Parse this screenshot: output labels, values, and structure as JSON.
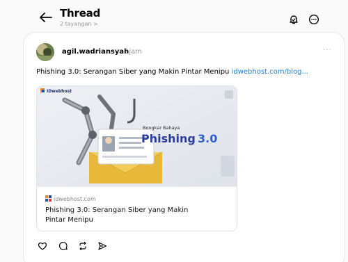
{
  "header": {
    "title": "Thread",
    "views": "2 tayangan",
    "views_chevron": ">",
    "icons": [
      "back-arrow-icon",
      "notification-bell-icon",
      "more-options-icon"
    ]
  },
  "post": {
    "username": "agil.wadriansyah",
    "time": "1jam",
    "more": "···",
    "text": "Phishing 3.0: Serangan Siber yang Makin Pintar Menipu",
    "link_text": "idwebhost.com/blog...",
    "preview": {
      "image_brand": "IDwebhost",
      "image_kicker": "Bongkar Bahaya",
      "image_headline_1": "Phishing",
      "image_headline_2": "3.0",
      "domain": "idwebhost.com",
      "title": "Phishing 3.0: Serangan Siber yang Makin Pintar Menipu"
    }
  },
  "actions": [
    "like-icon",
    "reply-icon",
    "repost-icon",
    "share-icon"
  ],
  "colors": {
    "background": "#fafafa",
    "card": "#ffffff",
    "link": "#1d7fd6",
    "muted": "#999999",
    "headline_blue": "#2a3c9e"
  }
}
